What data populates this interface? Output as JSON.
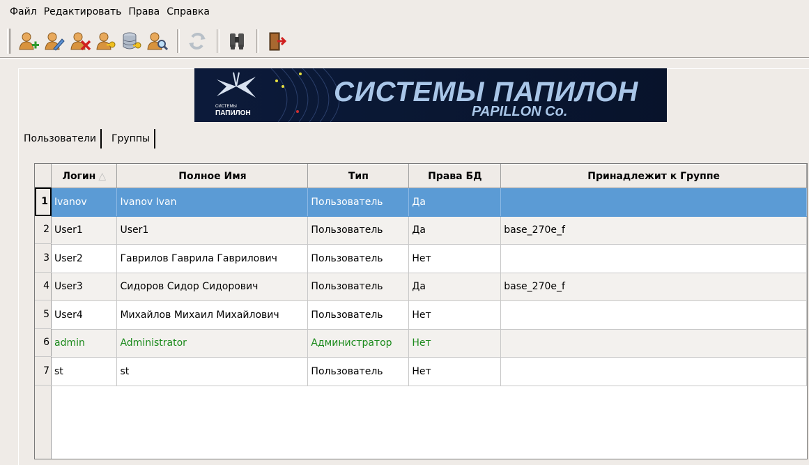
{
  "menu": [
    "Файл",
    "Редактировать",
    "Права",
    "Справка"
  ],
  "toolbar": {
    "icons": [
      "add-user-icon",
      "edit-user-icon",
      "delete-user-icon",
      "user-key-icon",
      "database-key-icon",
      "find-user-icon",
      "refresh-icon",
      "binoculars-icon",
      "exit-icon"
    ]
  },
  "banner": {
    "title": "СИСТЕМЫ ПАПИЛОН",
    "subtitle": "PAPILLON Co.",
    "logo_small": "СИСТЕМЫ",
    "logo_main": "ПАПИЛОН",
    "bg_color": "#0c1a3a"
  },
  "tabs": [
    "Пользователи",
    "Группы"
  ],
  "table": {
    "columns": [
      "Логин",
      "Полное Имя",
      "Тип",
      "Права БД",
      "Принадлежит к Группе"
    ],
    "rows": [
      {
        "num": "1",
        "login": "Ivanov",
        "name": "Ivanov Ivan",
        "type": "Пользователь",
        "rights": "Да",
        "group": ""
      },
      {
        "num": "2",
        "login": "User1",
        "name": "User1",
        "type": "Пользователь",
        "rights": "Да",
        "group": "base_270e_f"
      },
      {
        "num": "3",
        "login": "User2",
        "name": "Гаврилов Гаврила Гаврилович",
        "type": "Пользователь",
        "rights": "Нет",
        "group": ""
      },
      {
        "num": "4",
        "login": "User3",
        "name": "Сидоров Сидор Сидорович",
        "type": "Пользователь",
        "rights": "Да",
        "group": "base_270e_f"
      },
      {
        "num": "5",
        "login": "User4",
        "name": "Михайлов Михаил Михайлович",
        "type": "Пользователь",
        "rights": "Нет",
        "group": ""
      },
      {
        "num": "6",
        "login": "admin",
        "name": "Administrator",
        "type": "Администратор",
        "rights": "Нет",
        "group": ""
      },
      {
        "num": "7",
        "login": "st",
        "name": "st",
        "type": "Пользователь",
        "rights": "Нет",
        "group": ""
      }
    ],
    "selected_row_color": "#5b9bd5",
    "admin_text_color": "#1b8a1b"
  }
}
